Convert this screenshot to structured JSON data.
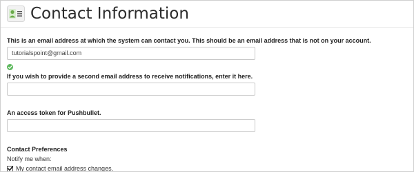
{
  "page": {
    "title": "Contact Information",
    "icon": "contact-card-icon"
  },
  "primary_email": {
    "label": "This is an email address at which the system can contact you. This should be an email address that is not on your account.",
    "value": "tutorialspoint@gmail.com",
    "status_icon": "check-circle-icon",
    "status_color": "#5cb85c"
  },
  "secondary_email": {
    "label": "If you wish to provide a second email address to receive notifications, enter it here.",
    "value": ""
  },
  "pushbullet": {
    "label": "An access token for Pushbullet.",
    "value": ""
  },
  "preferences": {
    "heading": "Contact Preferences",
    "notify_label": "Notify me when:",
    "options": [
      {
        "label": "My contact email address changes.",
        "checked": true
      }
    ]
  }
}
